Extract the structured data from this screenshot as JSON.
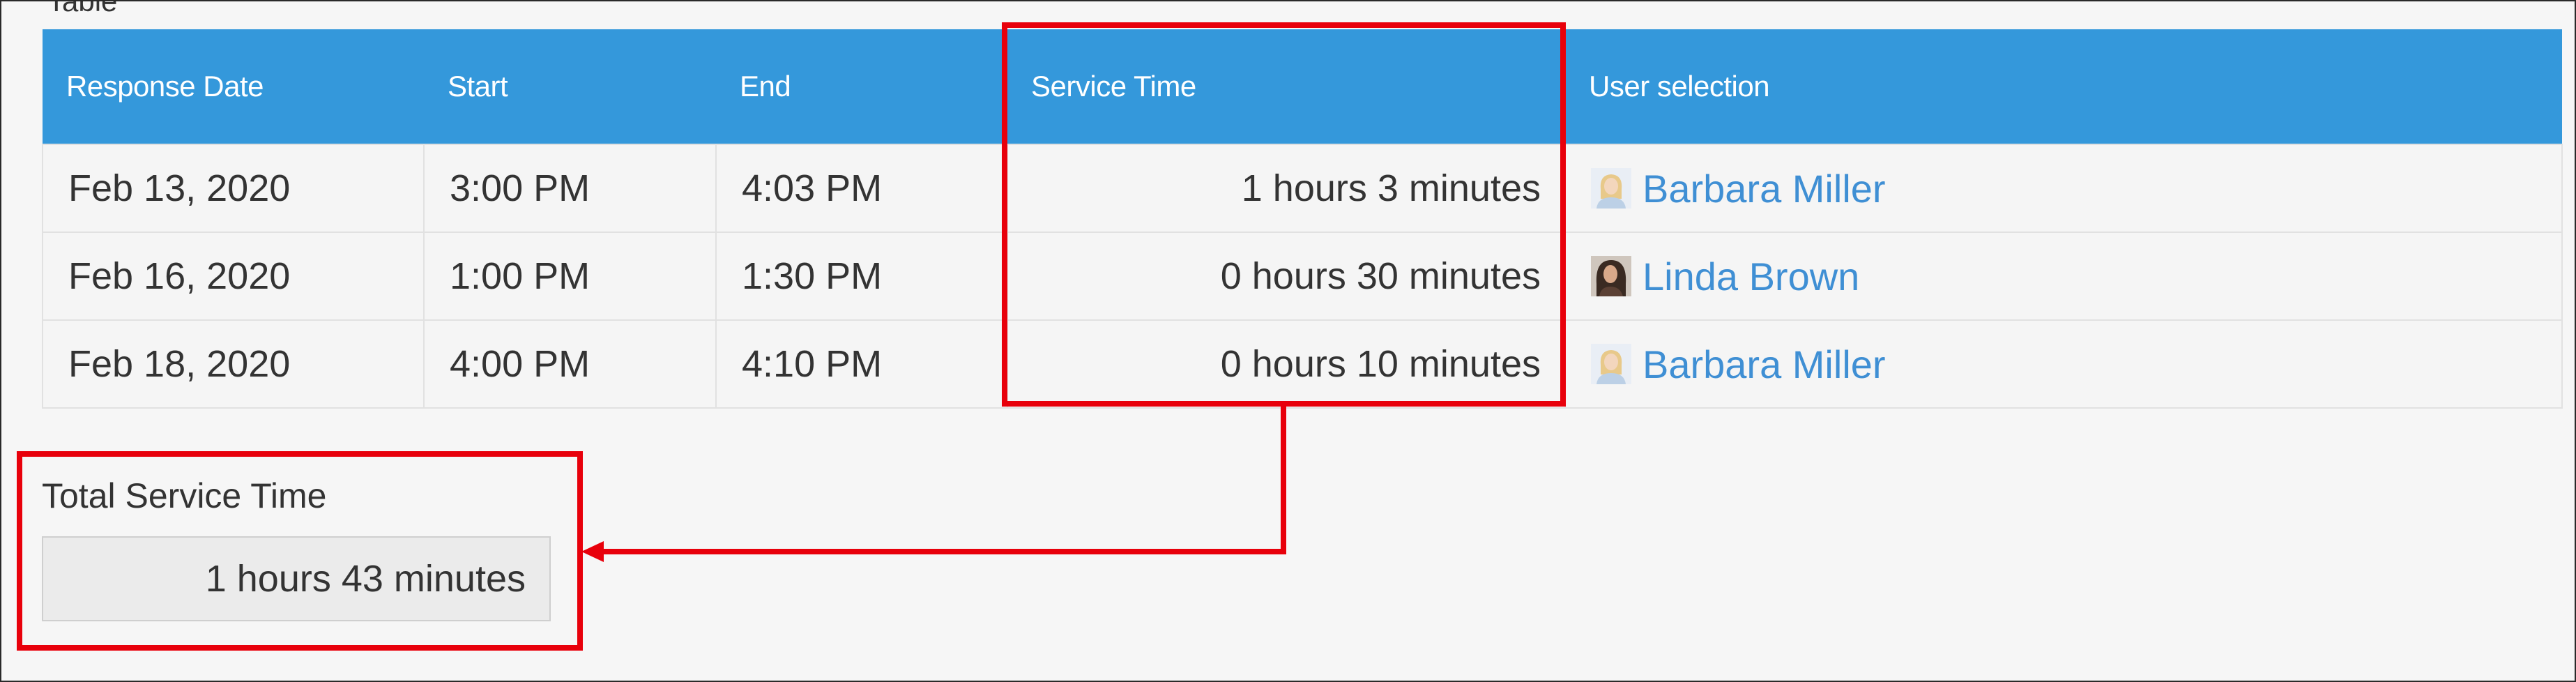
{
  "table": {
    "headers": {
      "response_date": "Response Date",
      "start": "Start",
      "end": "End",
      "service_time": "Service Time",
      "user_selection": "User selection"
    },
    "rows": [
      {
        "response_date": "Feb 13, 2020",
        "start": "3:00 PM",
        "end": "4:03 PM",
        "service_time": "1 hours 3 minutes",
        "user": "Barbara Miller",
        "avatar": "blonde-woman-avatar"
      },
      {
        "response_date": "Feb 16, 2020",
        "start": "1:00 PM",
        "end": "1:30 PM",
        "service_time": "0 hours 30 minutes",
        "user": "Linda Brown",
        "avatar": "dark-hair-woman-avatar"
      },
      {
        "response_date": "Feb 18, 2020",
        "start": "4:00 PM",
        "end": "4:10 PM",
        "service_time": "0 hours 10 minutes",
        "user": "Barbara Miller",
        "avatar": "blonde-woman-avatar"
      }
    ]
  },
  "total": {
    "label": "Total Service Time",
    "value": "1 hours 43 minutes"
  },
  "colors": {
    "header_bg": "#3498db",
    "link": "#3f8fd4",
    "annotation": "#e8000b"
  }
}
